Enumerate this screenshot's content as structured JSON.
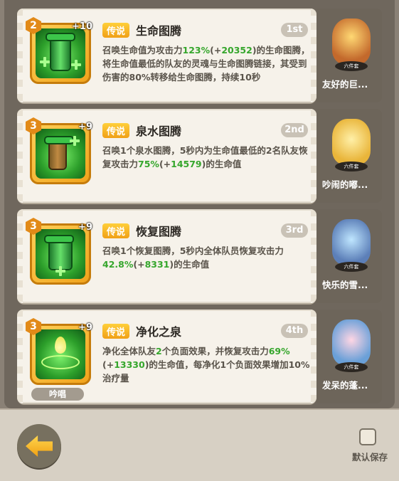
{
  "skills": [
    {
      "tag": "传说",
      "name": "生命图腾",
      "rank": "1st",
      "badge": "2",
      "level": "+10",
      "desc_parts": [
        "召唤生命值为攻击力",
        "123%",
        "(+",
        "20352",
        ")的生命图腾，将生命值最低的队友的灵魂与生命图腾链接，其受到伤害的80%转移给生命图腾，持续10秒"
      ]
    },
    {
      "tag": "传说",
      "name": "泉水图腾",
      "rank": "2nd",
      "badge": "3",
      "level": "+9",
      "desc_parts": [
        "召唤1个泉水图腾，5秒内为生命值最低的2名队友恢复攻击力",
        "75%",
        "(+",
        "14579",
        ")的生命值"
      ]
    },
    {
      "tag": "传说",
      "name": "恢复图腾",
      "rank": "3rd",
      "badge": "3",
      "level": "+9",
      "desc_parts": [
        "召唤1个恢复图腾，5秒内全体队员恢复攻击力",
        "42.8%",
        "(+",
        "8331",
        ")的生命值"
      ]
    },
    {
      "tag": "传说",
      "name": "净化之泉",
      "rank": "4th",
      "badge": "3",
      "level": "+9",
      "chant": "吟唱",
      "desc_parts": [
        "净化全体队友",
        "2",
        "个负面效果，并恢复攻击力",
        "69%",
        "(+",
        "13330",
        ")的生命值，每净化1个负面效果增加10%治疗量"
      ]
    }
  ],
  "heroes": [
    {
      "name": "友好的巨...",
      "set": "六件套"
    },
    {
      "name": "吵闹的嘟...",
      "set": "六件套"
    },
    {
      "name": "快乐的雪...",
      "set": "六件套"
    },
    {
      "name": "发呆的蓬...",
      "set": "六件套"
    }
  ],
  "footer": {
    "save_label": "默认保存"
  },
  "colors": {
    "highlight_green": "#35a62c",
    "legend_gold": "#f0a017",
    "card_bg": "#f6f2ea"
  }
}
